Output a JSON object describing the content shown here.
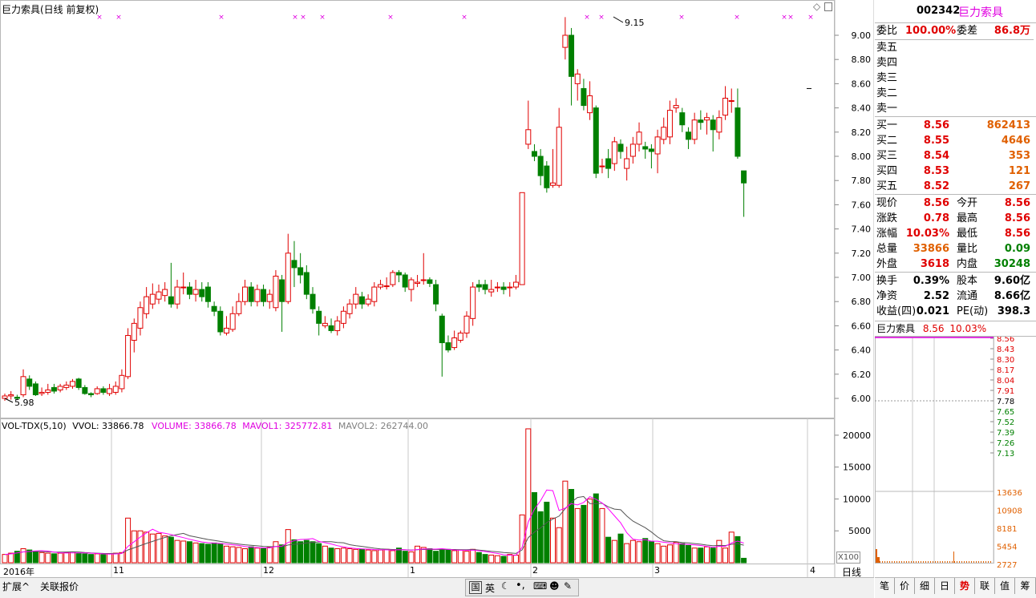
{
  "chart_title": "巨力索具(日线 前复权)",
  "price_axis": [
    "9.00",
    "8.80",
    "8.60",
    "8.40",
    "8.20",
    "8.00",
    "7.80",
    "7.60",
    "7.40",
    "7.20",
    "7.00",
    "6.80",
    "6.60",
    "6.40",
    "6.20",
    "6.00"
  ],
  "high_mark": "9.15",
  "low_mark": "5.98",
  "volume_legend": {
    "name": "VOL-TDX(5,10)",
    "vvol": "VVOL: 33866.78",
    "volume": "VOLUME: 33866.78",
    "mavol1": "MAVOL1: 325772.81",
    "mavol2": "MAVOL2: 262744.00"
  },
  "volume_axis": [
    "20000",
    "15000",
    "10000",
    "5000"
  ],
  "volume_unit": "X100",
  "date_labels": [
    "2016年",
    "11",
    "12",
    "1",
    "2",
    "3",
    "4"
  ],
  "period_label": "日线",
  "bottom_tabs": [
    "扩展^",
    "关联报价"
  ],
  "toolbar_icons": [
    "国",
    "英"
  ],
  "quote": {
    "code": "002342",
    "name": "巨力索具",
    "weibi_label": "委比",
    "weibi": "100.00%",
    "weicha_label": "委差",
    "weicha": "86.8万",
    "sell_labels": [
      "卖五",
      "卖四",
      "卖三",
      "卖二",
      "卖一"
    ],
    "buy": [
      {
        "label": "买一",
        "price": "8.56",
        "vol": "862413"
      },
      {
        "label": "买二",
        "price": "8.55",
        "vol": "4646"
      },
      {
        "label": "买三",
        "price": "8.54",
        "vol": "353"
      },
      {
        "label": "买四",
        "price": "8.53",
        "vol": "121"
      },
      {
        "label": "买五",
        "price": "8.52",
        "vol": "267"
      }
    ],
    "stats": [
      {
        "l1": "现价",
        "v1": "8.56",
        "l2": "今开",
        "v2": "8.56"
      },
      {
        "l1": "涨跌",
        "v1": "0.78",
        "l2": "最高",
        "v2": "8.56"
      },
      {
        "l1": "涨幅",
        "v1": "10.03%",
        "l2": "最低",
        "v2": "8.56"
      },
      {
        "l1": "总量",
        "v1": "33866",
        "l2": "量比",
        "v2": "0.09"
      },
      {
        "l1": "外盘",
        "v1": "3618",
        "l2": "内盘",
        "v2": "30248"
      }
    ],
    "fund": [
      {
        "l1": "换手",
        "v1": "0.39%",
        "l2": "股本",
        "v2": "9.60亿"
      },
      {
        "l1": "净资",
        "v1": "2.52",
        "l2": "流通",
        "v2": "8.66亿"
      },
      {
        "l1": "收益(四)",
        "v1": "0.021",
        "l2": "PE(动)",
        "v2": "398.3"
      }
    ]
  },
  "mini_chart": {
    "name": "巨力索具",
    "price": "8.56",
    "pct": "10.03%",
    "price_axis": [
      "8.56",
      "8.43",
      "8.30",
      "8.17",
      "8.04",
      "7.91",
      "7.78",
      "7.65",
      "7.52",
      "7.39",
      "7.26",
      "7.13"
    ],
    "vol_axis": [
      "13636",
      "10908",
      "8181",
      "5454",
      "2727"
    ]
  },
  "side_tabs": [
    "笔",
    "价",
    "细",
    "日",
    "势",
    "联",
    "值",
    "筹"
  ],
  "colors": {
    "up": "#e00000",
    "down": "#008000",
    "ma1": "#ff00ff",
    "ma2": "#555555",
    "grid": "#b8b8b8"
  },
  "chart_data": {
    "type": "candlestick",
    "title": "巨力索具(日线 前复权)",
    "ylim": [
      5.9,
      9.2
    ],
    "candles": [
      {
        "o": 6.0,
        "c": 6.02,
        "h": 6.04,
        "l": 5.98
      },
      {
        "o": 6.02,
        "c": 6.03,
        "h": 6.06,
        "l": 5.99
      },
      {
        "o": 6.01,
        "c": 6.0,
        "h": 6.03,
        "l": 5.99
      },
      {
        "o": 6.03,
        "c": 6.18,
        "h": 6.24,
        "l": 6.01
      },
      {
        "o": 6.16,
        "c": 6.1,
        "h": 6.19,
        "l": 6.07
      },
      {
        "o": 6.12,
        "c": 6.03,
        "h": 6.14,
        "l": 6.02
      },
      {
        "o": 6.04,
        "c": 6.05,
        "h": 6.09,
        "l": 6.02
      },
      {
        "o": 6.05,
        "c": 6.07,
        "h": 6.12,
        "l": 6.03
      },
      {
        "o": 6.09,
        "c": 6.06,
        "h": 6.12,
        "l": 6.04
      },
      {
        "o": 6.07,
        "c": 6.1,
        "h": 6.12,
        "l": 6.05
      },
      {
        "o": 6.09,
        "c": 6.11,
        "h": 6.14,
        "l": 6.07
      },
      {
        "o": 6.1,
        "c": 6.14,
        "h": 6.16,
        "l": 6.08
      },
      {
        "o": 6.16,
        "c": 6.09,
        "h": 6.17,
        "l": 6.07
      },
      {
        "o": 6.09,
        "c": 6.04,
        "h": 6.11,
        "l": 6.03
      },
      {
        "o": 6.04,
        "c": 6.03,
        "h": 6.05,
        "l": 6.01
      },
      {
        "o": 6.04,
        "c": 6.08,
        "h": 6.1,
        "l": 6.03
      },
      {
        "o": 6.08,
        "c": 6.05,
        "h": 6.1,
        "l": 6.03
      },
      {
        "o": 6.04,
        "c": 6.08,
        "h": 6.12,
        "l": 6.02
      },
      {
        "o": 6.05,
        "c": 6.1,
        "h": 6.14,
        "l": 6.03
      },
      {
        "o": 6.08,
        "c": 6.19,
        "h": 6.24,
        "l": 6.05
      },
      {
        "o": 6.18,
        "c": 6.52,
        "h": 6.58,
        "l": 6.16
      },
      {
        "o": 6.48,
        "c": 6.62,
        "h": 6.66,
        "l": 6.38
      },
      {
        "o": 6.58,
        "c": 6.75,
        "h": 6.8,
        "l": 6.52
      },
      {
        "o": 6.7,
        "c": 6.84,
        "h": 6.92,
        "l": 6.66
      },
      {
        "o": 6.78,
        "c": 6.86,
        "h": 6.95,
        "l": 6.74
      },
      {
        "o": 6.82,
        "c": 6.88,
        "h": 6.94,
        "l": 6.78
      },
      {
        "o": 6.85,
        "c": 6.9,
        "h": 6.96,
        "l": 6.8
      },
      {
        "o": 6.84,
        "c": 6.78,
        "h": 7.12,
        "l": 6.75
      },
      {
        "o": 6.78,
        "c": 6.92,
        "h": 6.98,
        "l": 6.74
      },
      {
        "o": 6.92,
        "c": 6.92,
        "h": 7.04,
        "l": 6.86
      },
      {
        "o": 6.92,
        "c": 6.86,
        "h": 6.96,
        "l": 6.82
      },
      {
        "o": 6.86,
        "c": 6.9,
        "h": 6.98,
        "l": 6.8
      },
      {
        "o": 6.9,
        "c": 6.84,
        "h": 6.96,
        "l": 6.8
      },
      {
        "o": 6.92,
        "c": 6.8,
        "h": 6.96,
        "l": 6.75
      },
      {
        "o": 6.76,
        "c": 6.72,
        "h": 6.8,
        "l": 6.68
      },
      {
        "o": 6.72,
        "c": 6.55,
        "h": 6.76,
        "l": 6.52
      },
      {
        "o": 6.54,
        "c": 6.58,
        "h": 6.68,
        "l": 6.52
      },
      {
        "o": 6.57,
        "c": 6.7,
        "h": 6.76,
        "l": 6.55
      },
      {
        "o": 6.7,
        "c": 6.8,
        "h": 6.87,
        "l": 6.68
      },
      {
        "o": 6.8,
        "c": 6.92,
        "h": 6.98,
        "l": 6.77
      },
      {
        "o": 6.92,
        "c": 6.8,
        "h": 6.96,
        "l": 6.76
      },
      {
        "o": 6.8,
        "c": 6.9,
        "h": 6.94,
        "l": 6.76
      },
      {
        "o": 6.9,
        "c": 6.8,
        "h": 6.94,
        "l": 6.76
      },
      {
        "o": 6.8,
        "c": 6.86,
        "h": 6.9,
        "l": 6.74
      },
      {
        "o": 6.75,
        "c": 7.01,
        "h": 7.06,
        "l": 6.72
      },
      {
        "o": 6.98,
        "c": 6.8,
        "h": 7.02,
        "l": 6.55
      },
      {
        "o": 6.8,
        "c": 7.2,
        "h": 7.36,
        "l": 6.78
      },
      {
        "o": 7.14,
        "c": 7.08,
        "h": 7.3,
        "l": 6.92
      },
      {
        "o": 7.08,
        "c": 7.02,
        "h": 7.2,
        "l": 6.95
      },
      {
        "o": 7.04,
        "c": 6.86,
        "h": 7.1,
        "l": 6.82
      },
      {
        "o": 6.86,
        "c": 6.74,
        "h": 6.92,
        "l": 6.7
      },
      {
        "o": 6.72,
        "c": 6.62,
        "h": 6.76,
        "l": 6.52
      },
      {
        "o": 6.6,
        "c": 6.62,
        "h": 6.68,
        "l": 6.58
      },
      {
        "o": 6.6,
        "c": 6.56,
        "h": 6.66,
        "l": 6.54
      },
      {
        "o": 6.56,
        "c": 6.64,
        "h": 6.68,
        "l": 6.52
      },
      {
        "o": 6.62,
        "c": 6.72,
        "h": 6.76,
        "l": 6.58
      },
      {
        "o": 6.7,
        "c": 6.78,
        "h": 6.82,
        "l": 6.66
      },
      {
        "o": 6.78,
        "c": 6.86,
        "h": 6.92,
        "l": 6.74
      },
      {
        "o": 6.84,
        "c": 6.78,
        "h": 6.88,
        "l": 6.74
      },
      {
        "o": 6.78,
        "c": 6.82,
        "h": 6.86,
        "l": 6.76
      },
      {
        "o": 6.8,
        "c": 6.92,
        "h": 6.96,
        "l": 6.76
      },
      {
        "o": 6.92,
        "c": 6.94,
        "h": 6.98,
        "l": 6.9
      },
      {
        "o": 6.93,
        "c": 6.93,
        "h": 7.0,
        "l": 6.9
      },
      {
        "o": 6.94,
        "c": 7.04,
        "h": 7.06,
        "l": 6.92
      },
      {
        "o": 7.04,
        "c": 7.02,
        "h": 7.06,
        "l": 6.96
      },
      {
        "o": 7.02,
        "c": 6.92,
        "h": 7.04,
        "l": 6.88
      },
      {
        "o": 6.9,
        "c": 6.98,
        "h": 7.0,
        "l": 6.8
      },
      {
        "o": 6.95,
        "c": 6.96,
        "h": 7.02,
        "l": 6.92
      },
      {
        "o": 6.98,
        "c": 6.98,
        "h": 7.2,
        "l": 6.94
      },
      {
        "o": 6.98,
        "c": 6.95,
        "h": 7.0,
        "l": 6.92
      },
      {
        "o": 6.94,
        "c": 6.78,
        "h": 6.98,
        "l": 6.72
      },
      {
        "o": 6.68,
        "c": 6.46,
        "h": 6.7,
        "l": 6.18
      },
      {
        "o": 6.46,
        "c": 6.4,
        "h": 6.52,
        "l": 6.38
      },
      {
        "o": 6.42,
        "c": 6.5,
        "h": 6.56,
        "l": 6.4
      },
      {
        "o": 6.48,
        "c": 6.54,
        "h": 6.56,
        "l": 6.46
      },
      {
        "o": 6.54,
        "c": 6.68,
        "h": 6.72,
        "l": 6.5
      },
      {
        "o": 6.66,
        "c": 6.92,
        "h": 6.96,
        "l": 6.6
      },
      {
        "o": 6.94,
        "c": 6.92,
        "h": 6.98,
        "l": 6.88
      },
      {
        "o": 6.94,
        "c": 6.9,
        "h": 6.98,
        "l": 6.86
      },
      {
        "o": 6.88,
        "c": 6.9,
        "h": 6.98,
        "l": 6.84
      },
      {
        "o": 6.92,
        "c": 6.92,
        "h": 6.96,
        "l": 6.88
      },
      {
        "o": 6.92,
        "c": 6.9,
        "h": 6.96,
        "l": 6.86
      },
      {
        "o": 6.92,
        "c": 6.92,
        "h": 6.96,
        "l": 6.84
      },
      {
        "o": 6.92,
        "c": 6.96,
        "h": 7.02,
        "l": 6.9
      },
      {
        "o": 6.94,
        "c": 7.7,
        "h": 7.7,
        "l": 6.94
      },
      {
        "o": 8.1,
        "c": 8.22,
        "h": 8.46,
        "l": 8.06
      },
      {
        "o": 8.04,
        "c": 8.0,
        "h": 8.1,
        "l": 7.96
      },
      {
        "o": 8.0,
        "c": 7.84,
        "h": 8.06,
        "l": 7.76
      },
      {
        "o": 7.92,
        "c": 7.74,
        "h": 7.96,
        "l": 7.7
      },
      {
        "o": 7.76,
        "c": 7.78,
        "h": 8.06,
        "l": 7.74
      },
      {
        "o": 7.76,
        "c": 8.24,
        "h": 8.4,
        "l": 7.74
      },
      {
        "o": 8.9,
        "c": 9.0,
        "h": 9.15,
        "l": 8.8
      },
      {
        "o": 9.0,
        "c": 8.66,
        "h": 9.06,
        "l": 8.42
      },
      {
        "o": 8.6,
        "c": 8.68,
        "h": 8.72,
        "l": 8.46
      },
      {
        "o": 8.56,
        "c": 8.42,
        "h": 8.64,
        "l": 8.38
      },
      {
        "o": 8.36,
        "c": 8.5,
        "h": 8.62,
        "l": 8.3
      },
      {
        "o": 8.4,
        "c": 7.86,
        "h": 8.42,
        "l": 7.82
      },
      {
        "o": 7.92,
        "c": 7.92,
        "h": 7.98,
        "l": 7.86
      },
      {
        "o": 7.98,
        "c": 7.9,
        "h": 8.06,
        "l": 7.82
      },
      {
        "o": 7.94,
        "c": 8.12,
        "h": 8.16,
        "l": 7.88
      },
      {
        "o": 8.1,
        "c": 8.04,
        "h": 8.14,
        "l": 7.98
      },
      {
        "o": 7.9,
        "c": 7.98,
        "h": 8.08,
        "l": 7.8
      },
      {
        "o": 8.0,
        "c": 8.1,
        "h": 8.16,
        "l": 7.94
      },
      {
        "o": 8.1,
        "c": 8.2,
        "h": 8.28,
        "l": 8.04
      },
      {
        "o": 8.08,
        "c": 8.06,
        "h": 8.12,
        "l": 7.98
      },
      {
        "o": 8.06,
        "c": 8.04,
        "h": 8.1,
        "l": 7.9
      },
      {
        "o": 8.02,
        "c": 8.16,
        "h": 8.22,
        "l": 7.86
      },
      {
        "o": 8.14,
        "c": 8.24,
        "h": 8.32,
        "l": 8.1
      },
      {
        "o": 8.16,
        "c": 8.38,
        "h": 8.46,
        "l": 8.1
      },
      {
        "o": 8.4,
        "c": 8.42,
        "h": 8.48,
        "l": 8.36
      },
      {
        "o": 8.36,
        "c": 8.26,
        "h": 8.4,
        "l": 8.2
      },
      {
        "o": 8.2,
        "c": 8.14,
        "h": 8.24,
        "l": 8.06
      },
      {
        "o": 8.14,
        "c": 8.3,
        "h": 8.36,
        "l": 8.1
      },
      {
        "o": 8.3,
        "c": 8.28,
        "h": 8.38,
        "l": 8.22
      },
      {
        "o": 8.3,
        "c": 8.32,
        "h": 8.36,
        "l": 8.18
      },
      {
        "o": 8.3,
        "c": 8.22,
        "h": 8.34,
        "l": 8.04
      },
      {
        "o": 8.2,
        "c": 8.32,
        "h": 8.38,
        "l": 8.14
      },
      {
        "o": 8.34,
        "c": 8.48,
        "h": 8.58,
        "l": 8.3
      },
      {
        "o": 8.46,
        "c": 8.46,
        "h": 8.56,
        "l": 8.36
      },
      {
        "o": 8.4,
        "c": 8.0,
        "h": 8.56,
        "l": 7.98
      },
      {
        "o": 7.88,
        "c": 7.78,
        "h": 7.88,
        "l": 7.5
      }
    ],
    "last_price": 8.56,
    "volume": [
      1300,
      1500,
      1800,
      2200,
      2000,
      1800,
      1600,
      1500,
      1400,
      1500,
      1600,
      1700,
      1500,
      1400,
      1300,
      1400,
      1300,
      1400,
      1500,
      1600,
      7000,
      5000,
      5000,
      4800,
      4500,
      4600,
      4200,
      4000,
      3500,
      3400,
      3300,
      3100,
      3000,
      2900,
      3100,
      3000,
      2600,
      2500,
      2400,
      2200,
      2500,
      2300,
      2200,
      2400,
      3300,
      2800,
      5200,
      3600,
      3300,
      3500,
      3300,
      3000,
      2600,
      2300,
      2200,
      2300,
      2200,
      2100,
      2100,
      2000,
      1900,
      2000,
      2100,
      1900,
      2300,
      1800,
      1700,
      2600,
      2400,
      2200,
      1800,
      2000,
      2100,
      1900,
      2000,
      1800,
      2100,
      1600,
      1300,
      1200,
      1100,
      1000,
      1300,
      1200,
      7500,
      21000,
      11000,
      8000,
      9500,
      7000,
      5500,
      12800,
      11500,
      8500,
      9000,
      10000,
      10800,
      8500,
      4000,
      3500,
      4500,
      3000,
      3500,
      3300,
      3800,
      3300,
      3000,
      2600,
      2800,
      3200,
      3000,
      2700,
      2300,
      2300,
      2500,
      2300,
      3500,
      2300,
      4800,
      4100,
      700
    ],
    "volume_ylim": [
      0,
      22000
    ],
    "mavol1_label": "MAVOL1",
    "mavol2_label": "MAVOL2"
  }
}
